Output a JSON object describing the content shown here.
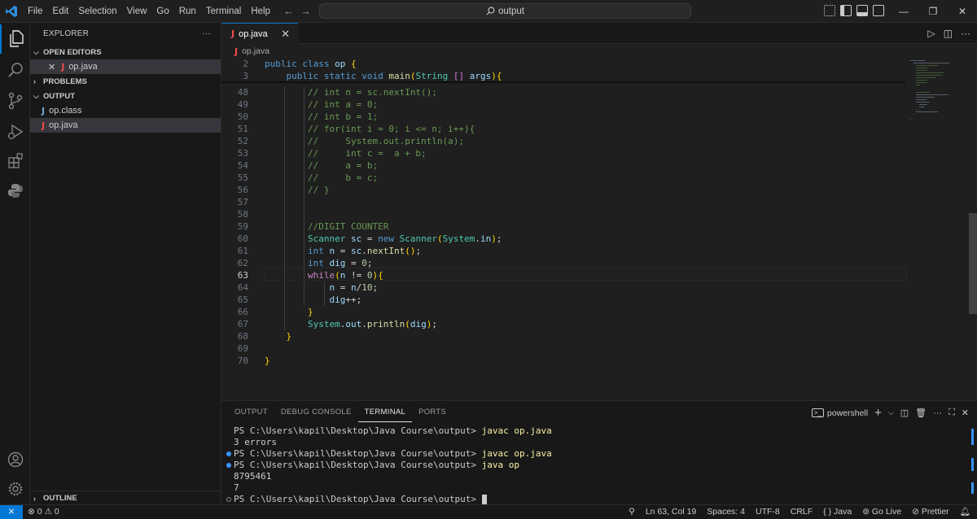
{
  "titlebar": {
    "menu": [
      "File",
      "Edit",
      "Selection",
      "View",
      "Go",
      "Run",
      "Terminal",
      "Help"
    ],
    "search": "output"
  },
  "sidebar": {
    "title": "EXPLORER",
    "more": "···",
    "open_editors_label": "OPEN EDITORS",
    "open_editor_file": "op.java",
    "problems_label": "PROBLEMS",
    "output_label": "OUTPUT",
    "files": [
      "op.class",
      "op.java"
    ],
    "outline_label": "OUTLINE"
  },
  "editor": {
    "tab_label": "op.java",
    "breadcrumb": "op.java",
    "sticky": [
      {
        "num": "2",
        "text": "public class op {"
      },
      {
        "num": "3",
        "text": "    public static void main(String [] args){"
      }
    ],
    "lines": [
      {
        "num": "48",
        "text": "        // int n = sc.nextInt();"
      },
      {
        "num": "49",
        "text": "        // int a = 0;"
      },
      {
        "num": "50",
        "text": "        // int b = 1;"
      },
      {
        "num": "51",
        "text": "        // for(int i = 0; i <= n; i++){"
      },
      {
        "num": "52",
        "text": "        //     System.out.println(a);"
      },
      {
        "num": "53",
        "text": "        //     int c =  a + b;"
      },
      {
        "num": "54",
        "text": "        //     a = b;"
      },
      {
        "num": "55",
        "text": "        //     b = c;"
      },
      {
        "num": "56",
        "text": "        // }"
      },
      {
        "num": "57",
        "text": ""
      },
      {
        "num": "58",
        "text": ""
      },
      {
        "num": "59",
        "text": "        //DIGIT COUNTER"
      },
      {
        "num": "60",
        "text": "        Scanner sc = new Scanner(System.in);"
      },
      {
        "num": "61",
        "text": "        int n = sc.nextInt();"
      },
      {
        "num": "62",
        "text": "        int dig = 0;"
      },
      {
        "num": "63",
        "text": "        while(n != 0){"
      },
      {
        "num": "64",
        "text": "            n = n/10;"
      },
      {
        "num": "65",
        "text": "            dig++;"
      },
      {
        "num": "66",
        "text": "        }"
      },
      {
        "num": "67",
        "text": "        System.out.println(dig);"
      },
      {
        "num": "68",
        "text": "    }"
      },
      {
        "num": "69",
        "text": ""
      },
      {
        "num": "70",
        "text": "}"
      }
    ]
  },
  "panel": {
    "tabs": [
      "OUTPUT",
      "DEBUG CONSOLE",
      "TERMINAL",
      "PORTS"
    ],
    "active_tab": "TERMINAL",
    "shell": "powershell",
    "terminal_lines": [
      {
        "prompt": "PS C:\\Users\\kapil\\Desktop\\Java Course\\output> ",
        "cmd": "javac op.java",
        "dot": "none"
      },
      {
        "prompt": "3 errors",
        "cmd": "",
        "dot": "none"
      },
      {
        "prompt": "PS C:\\Users\\kapil\\Desktop\\Java Course\\output> ",
        "cmd": "javac op.java",
        "dot": "blue"
      },
      {
        "prompt": "PS C:\\Users\\kapil\\Desktop\\Java Course\\output> ",
        "cmd": "java op",
        "dot": "blue"
      },
      {
        "prompt": "8795461",
        "cmd": "",
        "dot": "none"
      },
      {
        "prompt": "7",
        "cmd": "",
        "dot": "none"
      },
      {
        "prompt": "PS C:\\Users\\kapil\\Desktop\\Java Course\\output> ",
        "cmd": "",
        "dot": "hollow"
      }
    ]
  },
  "statusbar": {
    "problems": "⊗ 0 ⚠ 0",
    "position": "Ln 63, Col 19",
    "spaces": "Spaces: 4",
    "encoding": "UTF-8",
    "eol": "CRLF",
    "language": "{ } Java",
    "golive": "Go Live",
    "prettier": "Prettier"
  },
  "colors": {
    "accent": "#0078d4",
    "java_icon": "#f14c4c",
    "keyword": "#569cd6",
    "comment": "#6a9955",
    "type": "#4ec9b0",
    "function": "#dcdcaa"
  }
}
